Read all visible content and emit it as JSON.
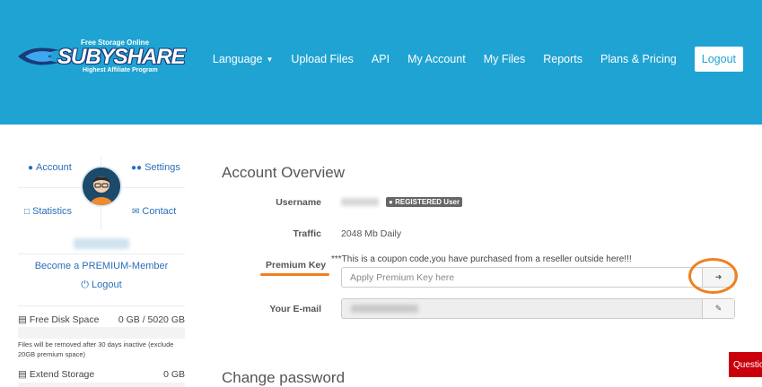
{
  "brand": {
    "name": "SUBYSHARE",
    "tagline_top": "Free Storage Online",
    "tagline_bottom": "Highest Affiliate Program",
    "colors": {
      "header_bg": "#1fa3d3",
      "link": "#2a6fb8",
      "accent": "#f08020",
      "question_bg": "#c9000c"
    }
  },
  "nav": {
    "items": [
      {
        "label": "Language",
        "icon": "caret-down-icon"
      },
      {
        "label": "Upload Files"
      },
      {
        "label": "API"
      },
      {
        "label": "My Account"
      },
      {
        "label": "My Files"
      },
      {
        "label": "Reports"
      },
      {
        "label": "Plans & Pricing"
      }
    ],
    "logout": "Logout"
  },
  "sidebar": {
    "links": {
      "account": {
        "label": "Account",
        "icon": "user-icon"
      },
      "settings": {
        "label": "Settings",
        "icon": "users-icon"
      },
      "statistics": {
        "label": "Statistics",
        "icon": "chart-area-icon"
      },
      "contact": {
        "label": "Contact",
        "icon": "envelope-icon"
      }
    },
    "premium_link": "Become a PREMIUM-Member",
    "logout_link": "Logout",
    "free_disk": {
      "label": "Free Disk Space",
      "value": "0 GB / 5020 GB",
      "fill_fraction": 0
    },
    "disk_note": "Files will be removed after 30 days inactive (exclude 20GB premium space)",
    "extend_storage": {
      "label": "Extend Storage",
      "value": "0 GB"
    }
  },
  "account": {
    "title": "Account Overview",
    "username_label": "Username",
    "badge": "REGISTERED User",
    "traffic_label": "Traffic",
    "traffic_value": "2048 Mb Daily",
    "premium_key_label": "Premium Key",
    "coupon_note": "***This is a coupon code,you have purchased from a reseller outside here!!!",
    "premium_key_placeholder": "Apply Premium Key here",
    "email_label": "Your E-mail"
  },
  "change_password": {
    "title": "Change password"
  },
  "question_tab": "Questions"
}
